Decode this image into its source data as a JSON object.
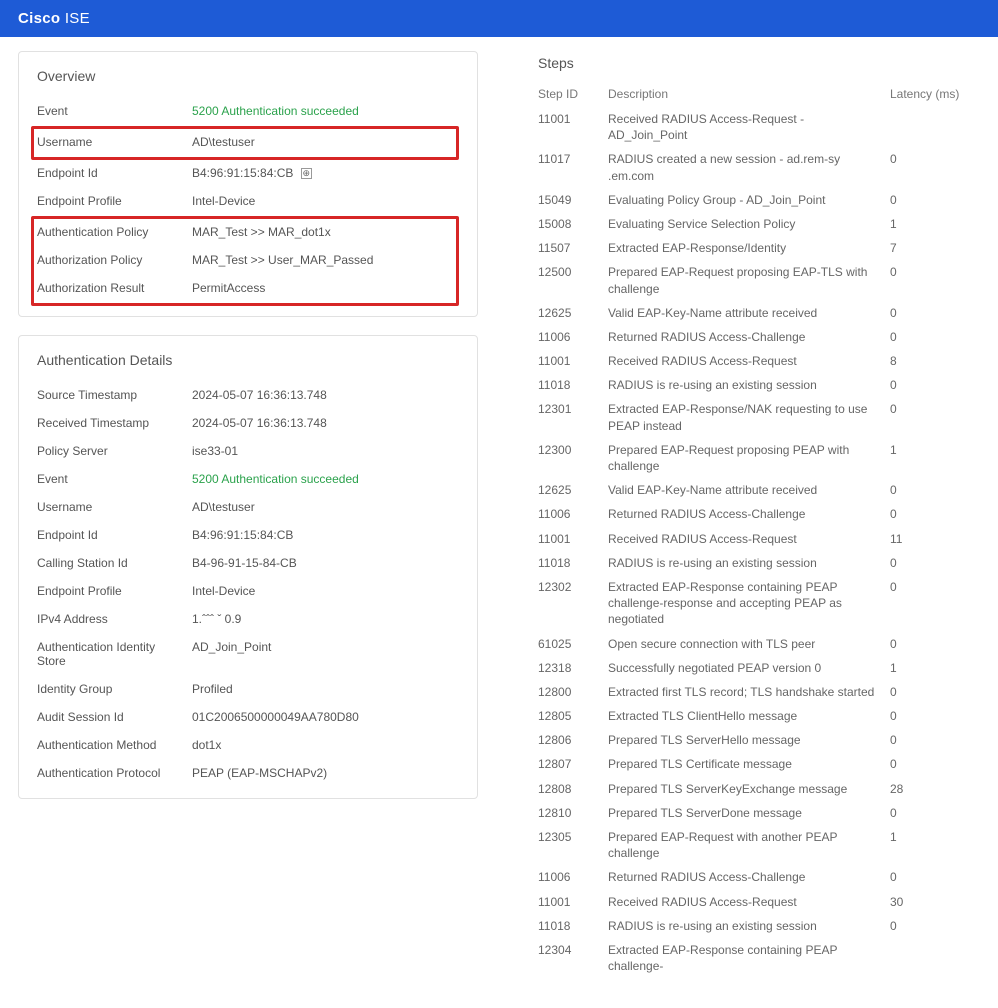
{
  "header": {
    "brand_bold": "Cisco",
    "brand_light": " ISE"
  },
  "overview": {
    "title": "Overview",
    "rows": {
      "event_label": "Event",
      "event_value": "5200 Authentication succeeded",
      "username_label": "Username",
      "username_value": "AD\\testuser",
      "endpoint_id_label": "Endpoint Id",
      "endpoint_id_value": "B4:96:91:15:84:CB",
      "endpoint_profile_label": "Endpoint Profile",
      "endpoint_profile_value": "Intel-Device",
      "authn_policy_label": "Authentication Policy",
      "authn_policy_value": "MAR_Test >> MAR_dot1x",
      "authz_policy_label": "Authorization Policy",
      "authz_policy_value": "MAR_Test >> User_MAR_Passed",
      "authz_result_label": "Authorization Result",
      "authz_result_value": "PermitAccess"
    }
  },
  "details": {
    "title": "Authentication Details",
    "rows": {
      "src_ts_label": "Source Timestamp",
      "src_ts_value": "2024-05-07 16:36:13.748",
      "recv_ts_label": "Received Timestamp",
      "recv_ts_value": "2024-05-07 16:36:13.748",
      "policy_server_label": "Policy Server",
      "policy_server_value": "ise33-01",
      "event_label": "Event",
      "event_value": "5200 Authentication succeeded",
      "username_label": "Username",
      "username_value": "AD\\testuser",
      "endpoint_id_label": "Endpoint Id",
      "endpoint_id_value": "B4:96:91:15:84:CB",
      "calling_station_label": "Calling Station Id",
      "calling_station_value": "B4-96-91-15-84-CB",
      "endpoint_profile_label": "Endpoint Profile",
      "endpoint_profile_value": "Intel-Device",
      "ipv4_label": "IPv4 Address",
      "ipv4_value": "1.ˆˆˆ ˇ 0.9",
      "auth_id_store_label": "Authentication Identity Store",
      "auth_id_store_value": "AD_Join_Point",
      "id_group_label": "Identity Group",
      "id_group_value": "Profiled",
      "audit_sid_label": "Audit Session Id",
      "audit_sid_value": "01C2006500000049AA780D80",
      "auth_method_label": "Authentication Method",
      "auth_method_value": "dot1x",
      "auth_proto_label": "Authentication Protocol",
      "auth_proto_value": "PEAP (EAP-MSCHAPv2)"
    }
  },
  "steps": {
    "title": "Steps",
    "columns": {
      "id": "Step ID",
      "desc": "Description",
      "lat": "Latency (ms)"
    },
    "items": [
      {
        "id": "11001",
        "desc": "Received RADIUS Access-Request - AD_Join_Point",
        "lat": ""
      },
      {
        "id": "11017",
        "desc": "RADIUS created a new session - ad.rem-sy  .em.com",
        "lat": "0"
      },
      {
        "id": "15049",
        "desc": "Evaluating Policy Group - AD_Join_Point",
        "lat": "0"
      },
      {
        "id": "15008",
        "desc": "Evaluating Service Selection Policy",
        "lat": "1"
      },
      {
        "id": "11507",
        "desc": "Extracted EAP-Response/Identity",
        "lat": "7"
      },
      {
        "id": "12500",
        "desc": "Prepared EAP-Request proposing EAP-TLS with challenge",
        "lat": "0"
      },
      {
        "id": "12625",
        "desc": "Valid EAP-Key-Name attribute received",
        "lat": "0"
      },
      {
        "id": "11006",
        "desc": "Returned RADIUS Access-Challenge",
        "lat": "0"
      },
      {
        "id": "11001",
        "desc": "Received RADIUS Access-Request",
        "lat": "8"
      },
      {
        "id": "11018",
        "desc": "RADIUS is re-using an existing session",
        "lat": "0"
      },
      {
        "id": "12301",
        "desc": "Extracted EAP-Response/NAK requesting to use PEAP instead",
        "lat": "0"
      },
      {
        "id": "12300",
        "desc": "Prepared EAP-Request proposing PEAP with challenge",
        "lat": "1"
      },
      {
        "id": "12625",
        "desc": "Valid EAP-Key-Name attribute received",
        "lat": "0"
      },
      {
        "id": "11006",
        "desc": "Returned RADIUS Access-Challenge",
        "lat": "0"
      },
      {
        "id": "11001",
        "desc": "Received RADIUS Access-Request",
        "lat": "11"
      },
      {
        "id": "11018",
        "desc": "RADIUS is re-using an existing session",
        "lat": "0"
      },
      {
        "id": "12302",
        "desc": "Extracted EAP-Response containing PEAP challenge-response and accepting PEAP as negotiated",
        "lat": "0"
      },
      {
        "id": "61025",
        "desc": "Open secure connection with TLS peer",
        "lat": "0"
      },
      {
        "id": "12318",
        "desc": "Successfully negotiated PEAP version 0",
        "lat": "1"
      },
      {
        "id": "12800",
        "desc": "Extracted first TLS record; TLS handshake started",
        "lat": "0"
      },
      {
        "id": "12805",
        "desc": "Extracted TLS ClientHello message",
        "lat": "0"
      },
      {
        "id": "12806",
        "desc": "Prepared TLS ServerHello message",
        "lat": "0"
      },
      {
        "id": "12807",
        "desc": "Prepared TLS Certificate message",
        "lat": "0"
      },
      {
        "id": "12808",
        "desc": "Prepared TLS ServerKeyExchange message",
        "lat": "28"
      },
      {
        "id": "12810",
        "desc": "Prepared TLS ServerDone message",
        "lat": "0"
      },
      {
        "id": "12305",
        "desc": "Prepared EAP-Request with another PEAP challenge",
        "lat": "1"
      },
      {
        "id": "11006",
        "desc": "Returned RADIUS Access-Challenge",
        "lat": "0"
      },
      {
        "id": "11001",
        "desc": "Received RADIUS Access-Request",
        "lat": "30"
      },
      {
        "id": "11018",
        "desc": "RADIUS is re-using an existing session",
        "lat": "0"
      },
      {
        "id": "12304",
        "desc": "Extracted EAP-Response containing PEAP challenge-",
        "lat": ""
      }
    ]
  }
}
